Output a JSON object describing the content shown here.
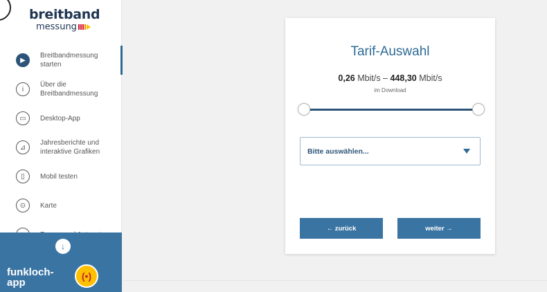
{
  "logo": {
    "top": "breitband",
    "bottom": "messung",
    "bar_colors": [
      "#c8102e",
      "#c8102e",
      "#e3051b",
      "#f28c00",
      "#ffc000"
    ]
  },
  "sidebar": {
    "items": [
      {
        "label_line1": "Breitbandmessung",
        "label_line2": "starten",
        "icon": "play-icon",
        "glyph": "▶",
        "active": true
      },
      {
        "label_line1": "Über die",
        "label_line2": "Breitbandmessung",
        "icon": "info-icon",
        "glyph": "i",
        "active": false
      },
      {
        "label_line1": "Desktop-App",
        "label_line2": "",
        "icon": "desktop-icon",
        "glyph": "▭",
        "active": false
      },
      {
        "label_line1": "Jahresberichte und",
        "label_line2": "interaktive Grafiken",
        "icon": "chart-icon",
        "glyph": "⊿",
        "active": false
      },
      {
        "label_line1": "Mobil testen",
        "label_line2": "",
        "icon": "mobile-icon",
        "glyph": "▯",
        "active": false
      },
      {
        "label_line1": "Karte",
        "label_line2": "",
        "icon": "map-pin-icon",
        "glyph": "⊙",
        "active": false
      },
      {
        "label_line1": "Fragen und Antworten",
        "label_line2": "",
        "icon": "chat-icon",
        "glyph": "▬",
        "active": false
      }
    ],
    "down_glyph": "↓",
    "funkloch": {
      "line1": "funkloch-",
      "line2": "app",
      "glyph": "(•)"
    }
  },
  "card": {
    "title": "Tarif-Auswahl",
    "speed_min_value": "0,26",
    "speed_min_unit": "Mbit/s",
    "speed_separator": "–",
    "speed_max_value": "448,30",
    "speed_max_unit": "Mbit/s",
    "speed_sub": "im Download",
    "slider_min_fraction": 0.0,
    "slider_max_fraction": 1.0,
    "select_placeholder": "Bitte auswählen...",
    "back_label": "← zurück",
    "next_label": "weiter →"
  },
  "colors": {
    "accent": "#3a74a3",
    "title": "#2d6a94",
    "funkloch_yellow": "#ffc000"
  }
}
